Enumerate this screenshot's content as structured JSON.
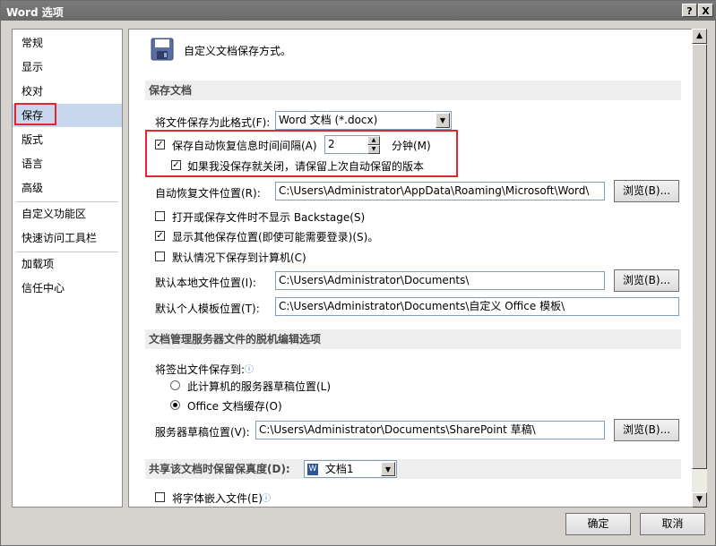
{
  "window": {
    "title": "Word 选项",
    "help_label": "?",
    "close_label": "X"
  },
  "nav": {
    "items": [
      {
        "label": "常规"
      },
      {
        "label": "显示"
      },
      {
        "label": "校对"
      },
      {
        "label": "保存"
      },
      {
        "label": "版式"
      },
      {
        "label": "语言"
      },
      {
        "label": "高级"
      },
      {
        "label": "自定义功能区"
      },
      {
        "label": "快速访问工具栏"
      },
      {
        "label": "加载项"
      },
      {
        "label": "信任中心"
      }
    ],
    "selected": "保存"
  },
  "header": {
    "text": "自定义文档保存方式。",
    "icon": "save-disk-icon"
  },
  "save_docs": {
    "section_title": "保存文档",
    "format_label": "将文件保存为此格式(F):",
    "format_value": "Word 文档 (*.docx)",
    "autorecover_label": "保存自动恢复信息时间间隔(A)",
    "autorecover_checked": true,
    "autorecover_minutes": "2",
    "minutes_label": "分钟(M)",
    "keep_last_label": "如果我没保存就关闭，请保留上次自动保留的版本",
    "keep_last_checked": true,
    "autorecover_location_label": "自动恢复文件位置(R):",
    "autorecover_location_value": "C:\\Users\\Administrator\\AppData\\Roaming\\Microsoft\\Word\\",
    "browse_label": "浏览(B)...",
    "no_backstage_label": "打开或保存文件时不显示 Backstage(S)",
    "no_backstage_checked": false,
    "show_other_label": "显示其他保存位置(即使可能需要登录)(S)。",
    "show_other_checked": true,
    "save_to_computer_label": "默认情况下保存到计算机(C)",
    "save_to_computer_checked": false,
    "default_local_label": "默认本地文件位置(I):",
    "default_local_value": "C:\\Users\\Administrator\\Documents\\",
    "default_template_label": "默认个人模板位置(T):",
    "default_template_value": "C:\\Users\\Administrator\\Documents\\自定义 Office 模板\\"
  },
  "offline": {
    "section_title": "文档管理服务器文件的脱机编辑选项",
    "checkout_label": "将签出文件保存到:",
    "radio_server_label": "此计算机的服务器草稿位置(L)",
    "radio_cache_label": "Office 文档缓存(O)",
    "selected_option": "Office 文档缓存(O)",
    "server_drafts_label": "服务器草稿位置(V):",
    "server_drafts_value": "C:\\Users\\Administrator\\Documents\\SharePoint 草稿\\"
  },
  "share": {
    "section_title": "共享该文档时保留保真度(D):",
    "doc_value": "文档1",
    "embed_fonts_label": "将字体嵌入文件(E)",
    "embed_fonts_checked": false
  },
  "footer": {
    "ok_label": "确定",
    "cancel_label": "取消"
  },
  "colors": {
    "highlight_red": "#e0262e",
    "nav_selected": "#c6d7ee",
    "section_bg": "#eeeeee"
  }
}
